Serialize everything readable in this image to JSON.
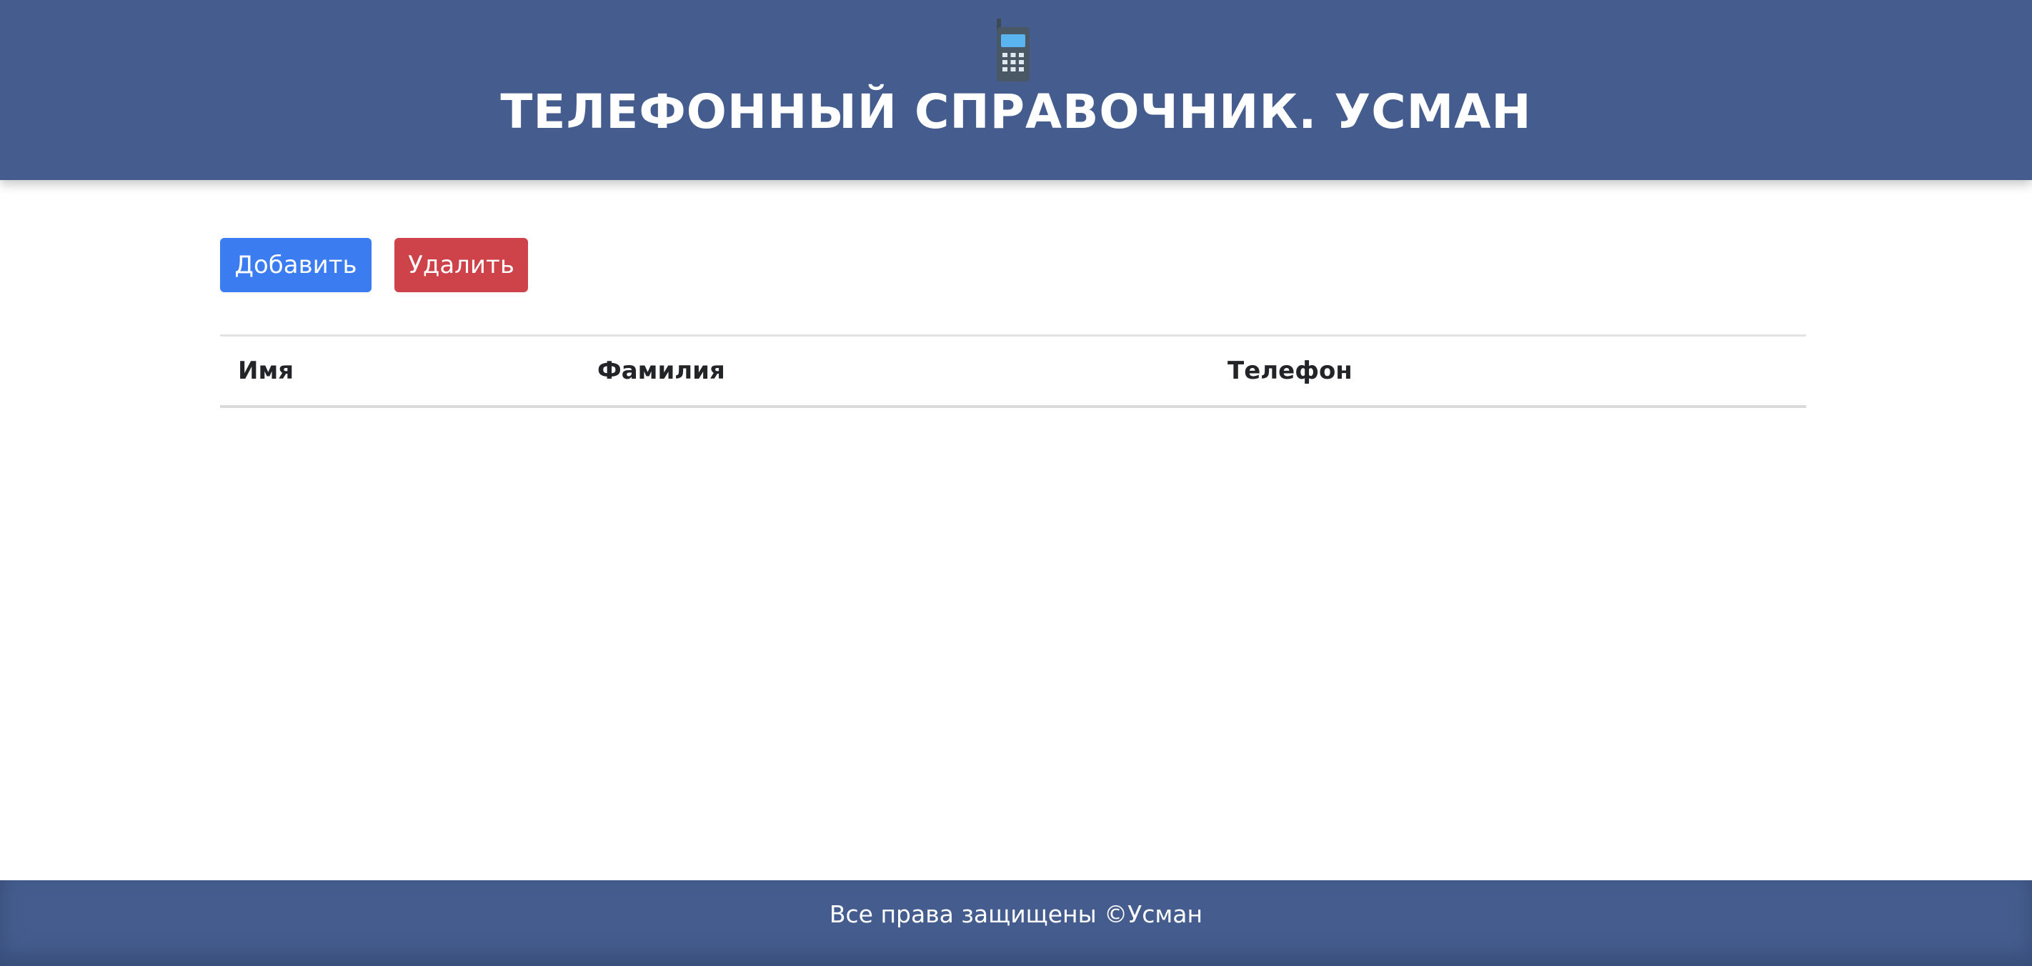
{
  "header": {
    "icon": "mobile-phone-icon",
    "title": "ТЕЛЕФОННЫЙ СПРАВОЧНИК. УСМАН"
  },
  "toolbar": {
    "add_label": "Добавить",
    "delete_label": "Удалить"
  },
  "table": {
    "columns": [
      "Имя",
      "Фамилия",
      "Телефон"
    ],
    "rows": []
  },
  "footer": {
    "text": "Все права защищены ©Усман"
  },
  "colors": {
    "header_bg": "#455d8e",
    "add_button": "#3b7cf1",
    "delete_button": "#ce4249",
    "footer_bg": "#455d8e"
  }
}
